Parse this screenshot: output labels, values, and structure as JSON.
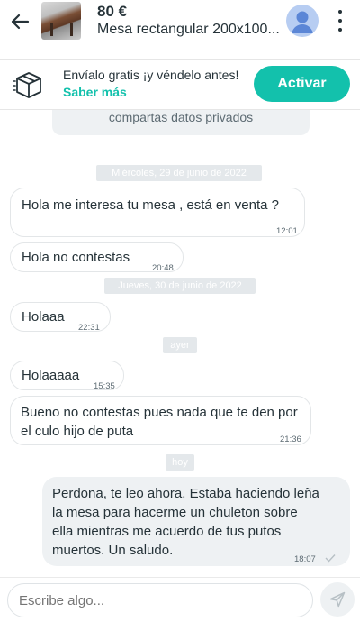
{
  "header": {
    "back_icon": "arrow-left-icon",
    "price": "80 €",
    "title": "Mesa rectangular 200x100...",
    "menu_icon": "more-vertical-icon"
  },
  "promo": {
    "icon": "package-box-icon",
    "text": "Envíalo gratis ¡y véndelo antes!",
    "link": "Saber más",
    "button": "Activar",
    "accent": "#13c1ac"
  },
  "chat": {
    "notice": "compartas datos privados",
    "dates": [
      "Miércoles, 29 de junio de 2022",
      "Jueves, 30 de junio de 2022",
      "ayer",
      "hoy"
    ],
    "messages": [
      {
        "text": "Hola me interesa tu mesa , está en venta ?",
        "time": "12:01"
      },
      {
        "text": "Hola no contestas",
        "time": "20:48"
      },
      {
        "text": "Holaaa",
        "time": "22:31"
      },
      {
        "text": "Holaaaaa",
        "time": "15:35"
      },
      {
        "text": "Bueno no contestas pues nada que te den por el culo hijo de puta",
        "time": "21:36"
      },
      {
        "text": "Perdona, te leo ahora. Estaba haciendo leña la mesa para hacerme un chuleton sobre ella mientras me acuerdo de tus putos muertos. Un saludo.",
        "time": "18:07"
      }
    ]
  },
  "input": {
    "placeholder": "Escribe algo...",
    "send_icon": "send-icon"
  }
}
